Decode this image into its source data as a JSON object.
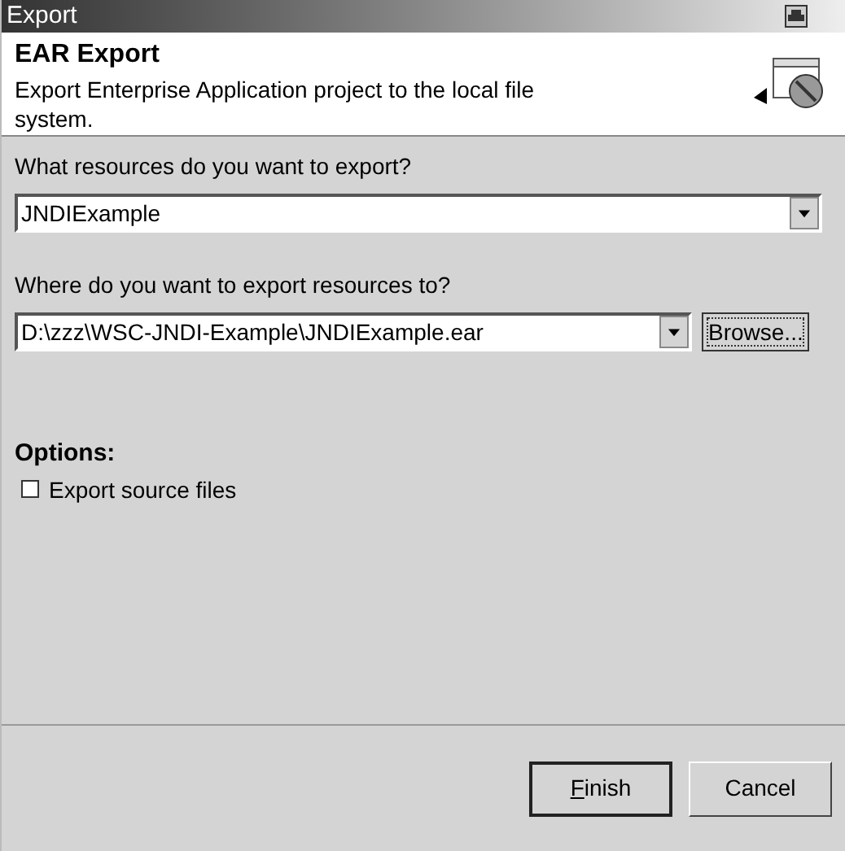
{
  "window": {
    "title": "Export"
  },
  "header": {
    "title": "EAR Export",
    "description": "Export Enterprise Application project to the local file system."
  },
  "resources": {
    "label": "What resources do you want to export?",
    "value": "JNDIExample"
  },
  "destination": {
    "label": "Where do you want to export resources to?",
    "value": "D:\\zzz\\WSC-JNDI-Example\\JNDIExample.ear",
    "browse": "Browse..."
  },
  "options": {
    "title": "Options:",
    "items": [
      {
        "label": "Export source files",
        "checked": false
      }
    ]
  },
  "buttons": [
    {
      "label": "Finish",
      "mnemonic_underlined": true,
      "default": true
    },
    {
      "label": "Cancel",
      "default": false
    }
  ]
}
